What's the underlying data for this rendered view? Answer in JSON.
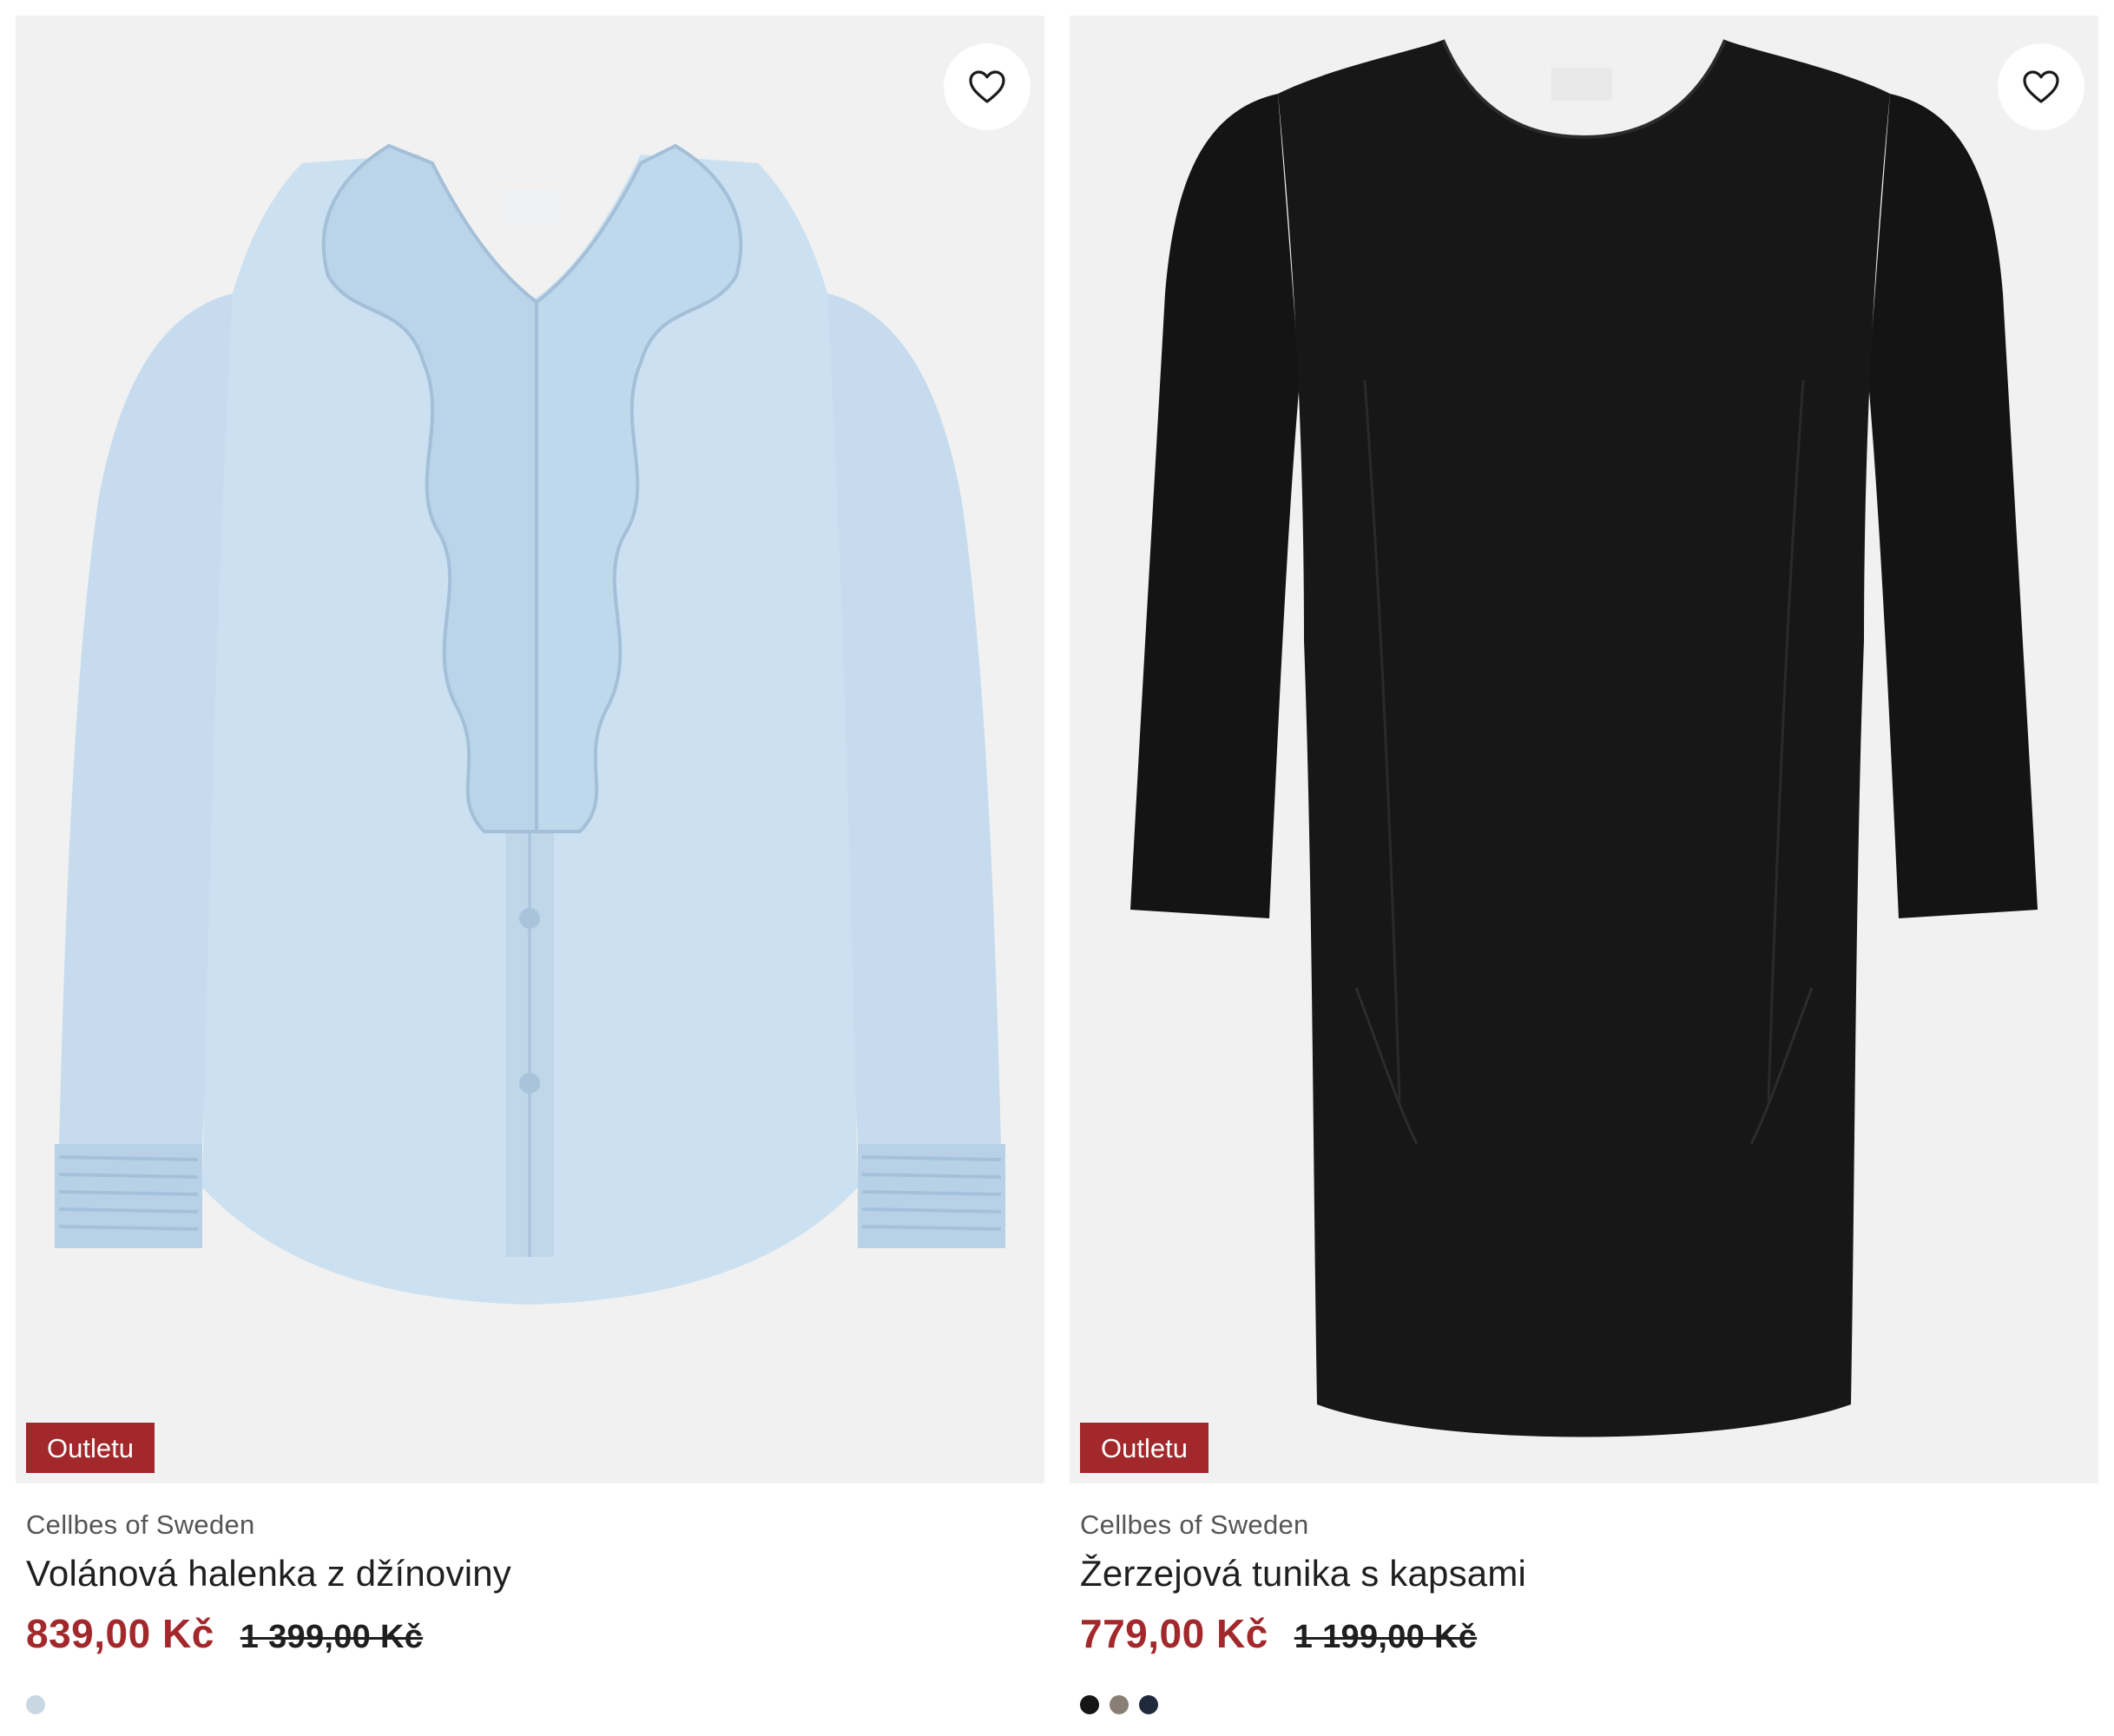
{
  "products": [
    {
      "brand": "Cellbes of Sweden",
      "title": "Volánová halenka z džínoviny",
      "badge": "Outletu",
      "price_now": "839,00 Kč",
      "price_old": "1 399,00 Kč",
      "image_icon": "denim-ruffle-blouse-image",
      "swatches": [
        "#c9d7e3"
      ]
    },
    {
      "brand": "Cellbes of Sweden",
      "title": "Žerzejová tunika s kapsami",
      "badge": "Outletu",
      "price_now": "779,00 Kč",
      "price_old": "1 199,00 Kč",
      "image_icon": "black-jersey-tunic-image",
      "swatches": [
        "#151515",
        "#8a7f75",
        "#1f2a3d"
      ]
    }
  ],
  "colors": {
    "accent": "#a3282c",
    "image_bg": "#f1f1f1"
  }
}
